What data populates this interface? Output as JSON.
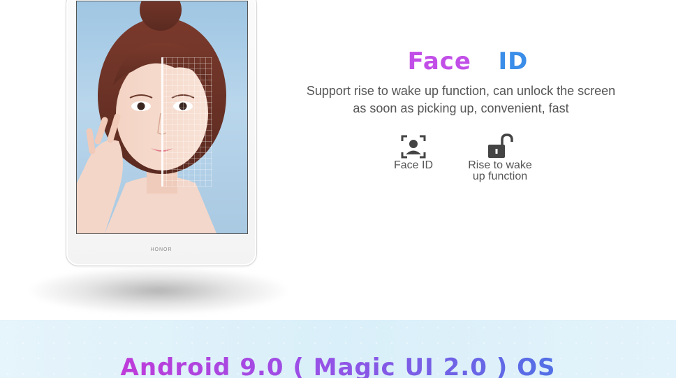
{
  "product": {
    "brand": "HONOR"
  },
  "feature": {
    "title_part1": "Face",
    "title_part2": "ID",
    "description_line1": "Support rise to wake up function, can unlock the screen",
    "description_line2": "as soon as picking up, convenient, fast",
    "items": [
      {
        "icon": "face-scan-icon",
        "label": "Face ID"
      },
      {
        "icon": "unlock-icon",
        "label_line1": "Rise to wake",
        "label_line2": "up function"
      }
    ]
  },
  "banner": {
    "title": "Android 9.0 ( Magic UI 2.0 ) OS"
  },
  "colors": {
    "title_magenta": "#c24ee8",
    "title_blue": "#3a8de8",
    "banner_bg": "#dcf0fa",
    "text_gray": "#555555"
  }
}
